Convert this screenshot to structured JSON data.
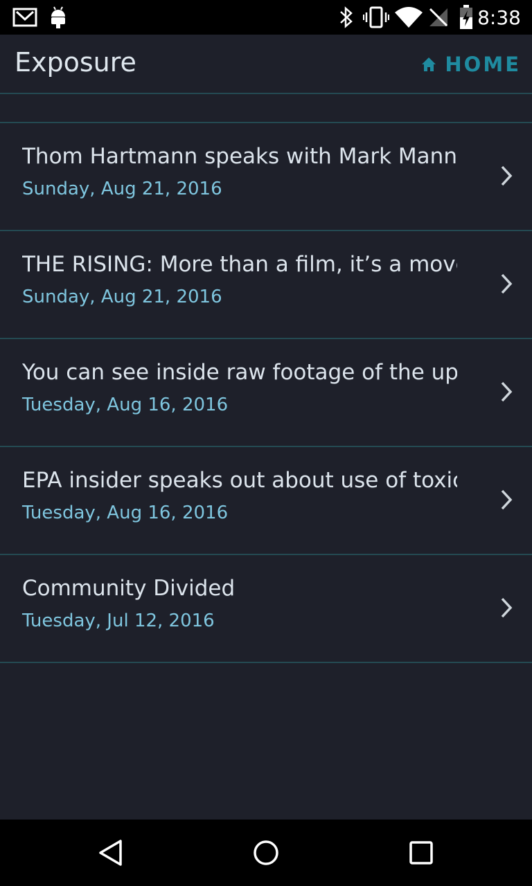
{
  "status_bar": {
    "time": "8:38",
    "icons": [
      "gmail-icon",
      "android-icon",
      "bluetooth-icon",
      "vibrate-icon",
      "wifi-icon",
      "no-signal-icon",
      "battery-charging-icon"
    ]
  },
  "app_bar": {
    "title": "Exposure",
    "home_label": "HOME",
    "home_icon": "home-icon",
    "accent_color": "#1f8ba0"
  },
  "items": [
    {
      "title": "Thom Hartmann speaks with Mark Manning",
      "date": "Sunday, Aug 21, 2016"
    },
    {
      "title": "THE RISING: More than a film, it’s a movem..",
      "date": "Sunday, Aug 21, 2016"
    },
    {
      "title": "You can see inside raw footage of the upco..",
      "date": "Tuesday, Aug 16, 2016"
    },
    {
      "title": "EPA insider speaks out about use of toxic d..",
      "date": "Tuesday, Aug 16, 2016"
    },
    {
      "title": "Community Divided",
      "date": "Tuesday, Jul 12, 2016"
    }
  ],
  "nav_bar": {
    "back_icon": "back-icon",
    "home_icon": "home-circle-icon",
    "recents_icon": "recents-icon"
  }
}
